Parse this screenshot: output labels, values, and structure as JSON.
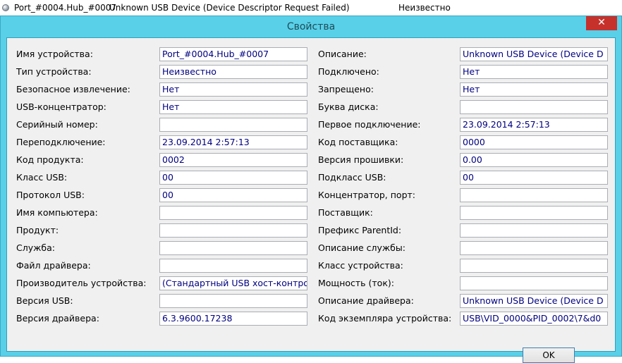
{
  "background_row": {
    "port": "Port_#0004.Hub_#0007",
    "description": "Unknown USB Device (Device Descriptor Request Failed)",
    "status": "Неизвестно"
  },
  "dialog": {
    "title": "Свойства",
    "close_glyph": "✕",
    "ok_label": "OK"
  },
  "left": [
    {
      "label": "Имя устройства:",
      "value": "Port_#0004.Hub_#0007"
    },
    {
      "label": "Тип устройства:",
      "value": "Неизвестно"
    },
    {
      "label": "Безопасное извлечение:",
      "value": "Нет"
    },
    {
      "label": "USB-концентратор:",
      "value": "Нет"
    },
    {
      "label": "Серийный номер:",
      "value": ""
    },
    {
      "label": "Переподключение:",
      "value": "23.09.2014 2:57:13"
    },
    {
      "label": "Код продукта:",
      "value": "0002"
    },
    {
      "label": "Класс USB:",
      "value": "00"
    },
    {
      "label": "Протокол USB:",
      "value": "00"
    },
    {
      "label": "Имя компьютера:",
      "value": ""
    },
    {
      "label": "Продукт:",
      "value": ""
    },
    {
      "label": "Служба:",
      "value": ""
    },
    {
      "label": "Файл драйвера:",
      "value": ""
    },
    {
      "label": "Производитель устройства:",
      "value": "(Стандартный USB хост-контро"
    },
    {
      "label": "Версия USB:",
      "value": ""
    },
    {
      "label": "Версия драйвера:",
      "value": "6.3.9600.17238"
    }
  ],
  "right": [
    {
      "label": "Описание:",
      "value": "Unknown USB Device (Device D"
    },
    {
      "label": "Подключено:",
      "value": "Нет"
    },
    {
      "label": "Запрещено:",
      "value": "Нет"
    },
    {
      "label": "Буква диска:",
      "value": ""
    },
    {
      "label": "Первое подключение:",
      "value": "23.09.2014 2:57:13"
    },
    {
      "label": "Код поставщика:",
      "value": "0000"
    },
    {
      "label": "Версия прошивки:",
      "value": "0.00"
    },
    {
      "label": "Подкласс USB:",
      "value": "00"
    },
    {
      "label": "Концентратор, порт:",
      "value": ""
    },
    {
      "label": "Поставщик:",
      "value": ""
    },
    {
      "label": "Префикс ParentId:",
      "value": ""
    },
    {
      "label": "Описание службы:",
      "value": ""
    },
    {
      "label": "Класс устройства:",
      "value": ""
    },
    {
      "label": "Мощность (ток):",
      "value": ""
    },
    {
      "label": "Описание драйвера:",
      "value": "Unknown USB Device (Device D"
    },
    {
      "label": "Код экземпляра устройства:",
      "value": "USB\\VID_0000&PID_0002\\7&d0"
    }
  ]
}
